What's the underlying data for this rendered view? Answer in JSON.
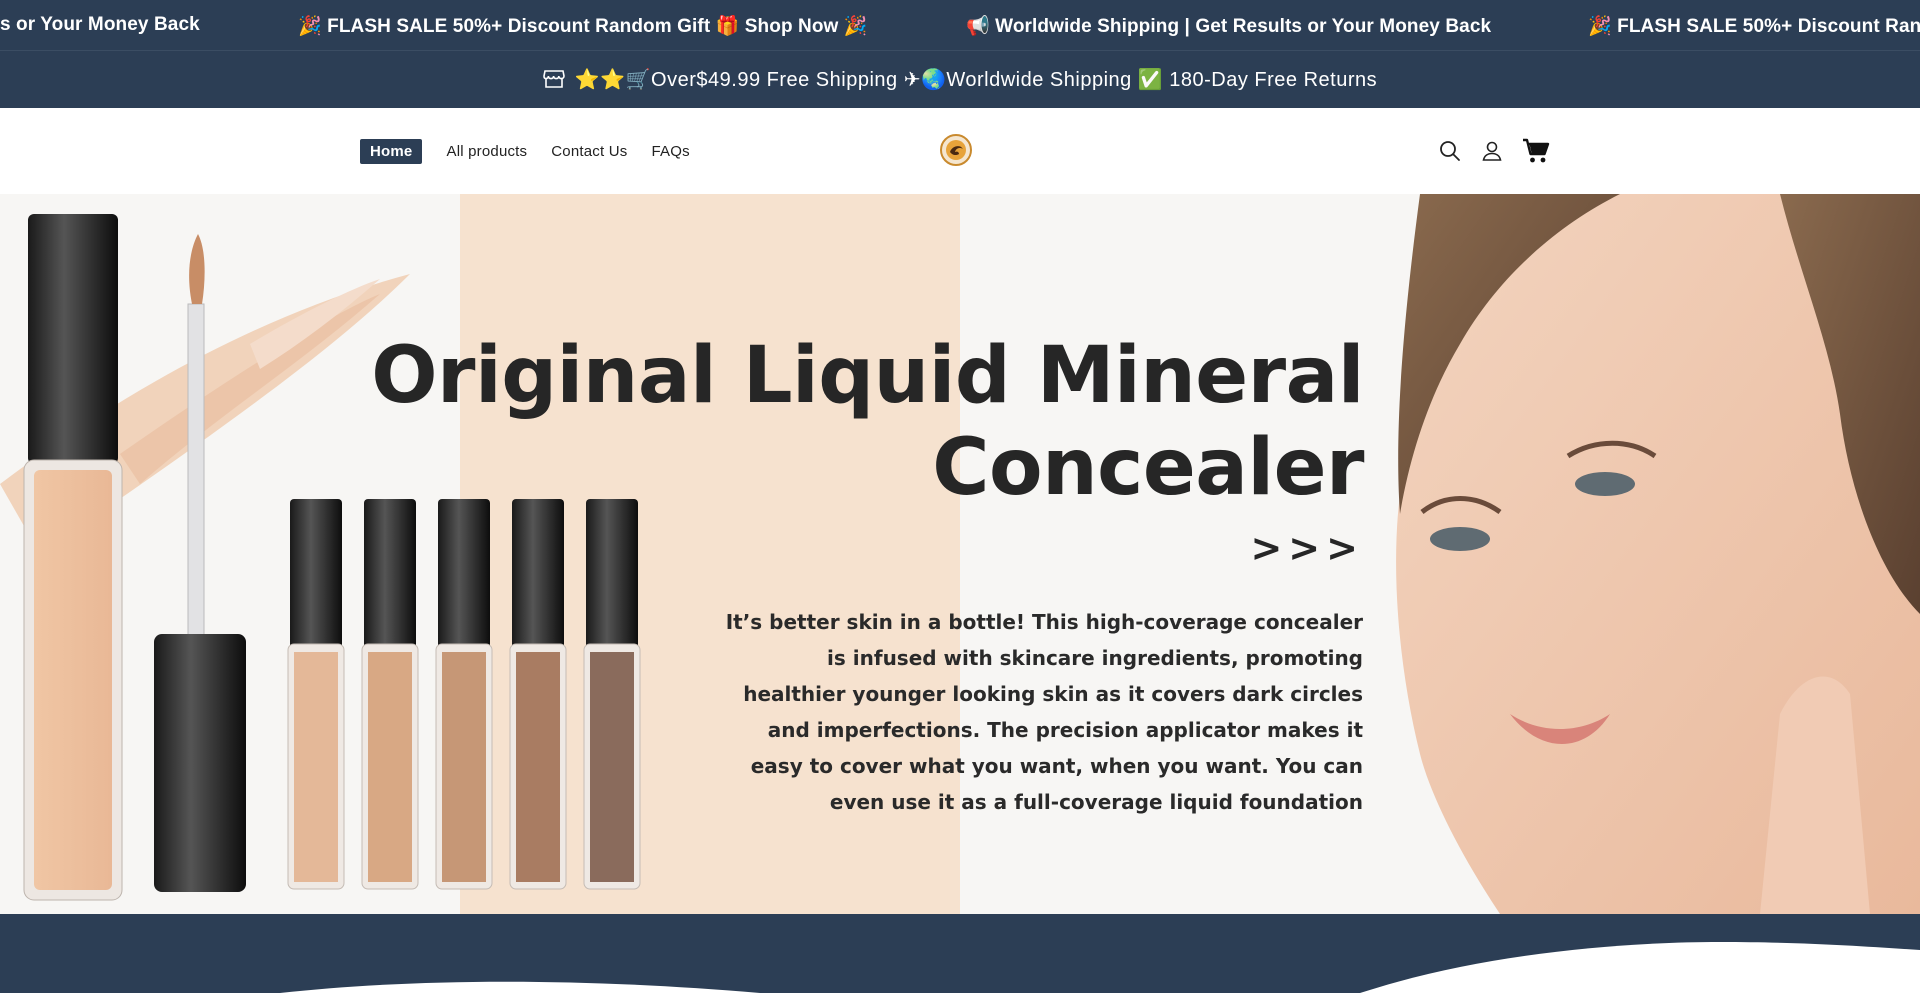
{
  "marquee": {
    "items": [
      "s or Your Money Back",
      "🎉 FLASH SALE 50%+ Discount Random Gift 🎁 Shop Now 🎉",
      "📢 Worldwide Shipping | Get Results or Your Money Back",
      "🎉 FLASH SALE 50%+ Discount Ran"
    ]
  },
  "announcement": {
    "text": "⭐⭐🛒Over$49.99 Free Shipping ✈🌏Worldwide Shipping ✅ 180-Day Free Returns",
    "icon": "store-icon"
  },
  "nav": {
    "items": [
      "Home",
      "All products",
      "Contact Us",
      "FAQs"
    ],
    "active": "Home"
  },
  "header_icons": [
    "search-icon",
    "account-icon",
    "cart-icon"
  ],
  "hero": {
    "title_line1": "Original Liquid Mineral",
    "title_line2": "Concealer",
    "arrows": ">>>",
    "description": "It’s better skin in a bottle! This high-coverage concealer is infused with skincare ingredients, promoting healthier younger looking skin as it covers dark circles and imperfections. The precision applicator makes it easy to cover what you want, when you want. You can even use it as a full-coverage liquid foundation"
  },
  "colors": {
    "brand_dark": "#2c3e55",
    "hero_peach": "#f6e2cf"
  }
}
